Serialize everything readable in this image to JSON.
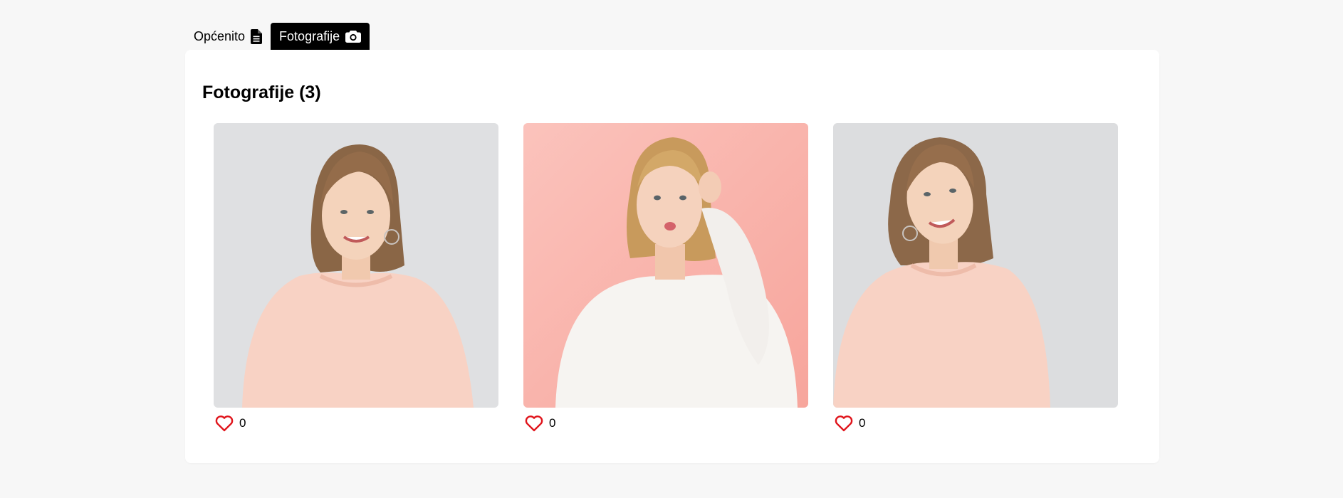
{
  "tabs": [
    {
      "label": "Općenito",
      "icon": "document-icon",
      "active": false
    },
    {
      "label": "Fotografije",
      "icon": "camera-icon",
      "active": true
    }
  ],
  "gallery": {
    "title": "Fotografije (3)",
    "photos": [
      {
        "likes": "0",
        "background": "#dfe0e2",
        "sweater": "#f8d2c4"
      },
      {
        "likes": "0",
        "background": "#f9b5ae",
        "sweater": "#f6f4f1"
      },
      {
        "likes": "0",
        "background": "#dcdddf",
        "sweater": "#f8d2c4"
      }
    ]
  },
  "colors": {
    "heart": "#e0141b",
    "active_tab": "#000000",
    "card": "#ffffff",
    "page": "#f7f7f7"
  }
}
